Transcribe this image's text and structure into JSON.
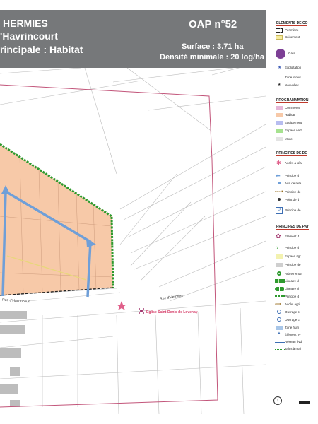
{
  "header": {
    "commune": "HERMIES",
    "street": "'Havrincourt",
    "vocation": "rincipale : Habitat",
    "oap_number": "OAP n°52",
    "surface": "Surface : 3.71 ha",
    "density": "Densité minimale : 20 log/ha"
  },
  "map_labels": {
    "street_havrincourt": "Rue d'Havrincourt",
    "street_hermies": "Rue d'Hermies",
    "church": "Église Saint-Denis de Lovenay"
  },
  "legend": {
    "heading_elements": "ELEMENTS DE CO",
    "items_elements": [
      "Périmètre",
      "Boisement",
      "Gare",
      "Exploitation",
      "Zone inond",
      "Nouvelles"
    ],
    "heading_programming": "PROGRAMMATION",
    "items_programming": [
      "Commerce",
      "Habitat",
      "Equipement",
      "Espace vert",
      "Mixte"
    ],
    "heading_principles": "PRINCIPES DE DE",
    "items_principles": [
      "Accès à réal",
      "Principe d",
      "Aire de rete",
      "Principe de",
      "Point de d",
      "Principe de"
    ],
    "heading_landscape": "PRINCIPES DE PAY",
    "items_landscape": [
      "Élément d",
      "Principe d",
      "Espace agr",
      "Principe de",
      "Arbre remar",
      "Linéaire d",
      "Linéaire d",
      "Principe d",
      "Accès agri",
      "Ouvrage c",
      "Ouvrage c",
      "Zone hum",
      "Élément hy",
      "Réseau hyd",
      "Talus à mai"
    ]
  },
  "colors": {
    "header_bg": "#76787a",
    "habitat": "#f7c9a8",
    "green_belt": "#2e9a2e",
    "principle_arrow": "#6f9fd8",
    "perimeter_pink": "#c2557a",
    "dashed_border": "#222222"
  }
}
